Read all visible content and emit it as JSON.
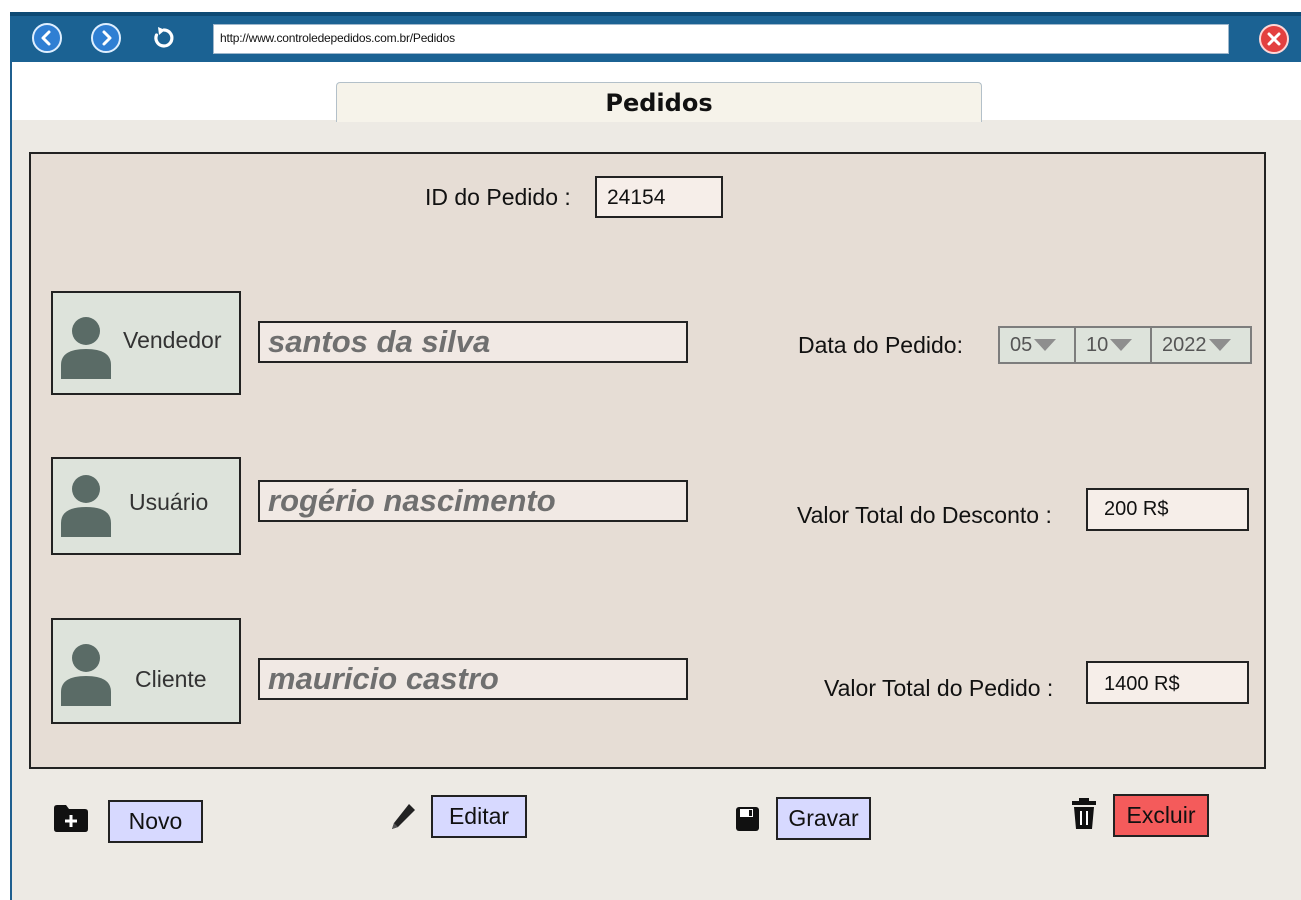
{
  "browser": {
    "url": "http://www.controledepedidos.com.br/Pedidos",
    "icons": [
      "back-icon",
      "forward-icon",
      "reload-icon",
      "close-icon"
    ]
  },
  "page": {
    "tab_title": "Pedidos"
  },
  "order": {
    "id_label": "ID do Pedido :",
    "id_value": "24154",
    "date_label": "Data do Pedido:",
    "date_day": "05",
    "date_month": "10",
    "date_year": "2022",
    "discount_label": "Valor Total do Desconto :",
    "discount_value": "200 R$",
    "total_label": "Valor Total do Pedido :",
    "total_value": "1400 R$"
  },
  "people": {
    "vendedor_label": "Vendedor",
    "vendedor_value": "santos da silva",
    "usuario_label": "Usuário",
    "usuario_value": "rogério nascimento",
    "cliente_label": "Cliente",
    "cliente_value": "mauricio castro"
  },
  "actions": {
    "novo": "Novo",
    "editar": "Editar",
    "gravar": "Gravar",
    "excluir": "Excluir"
  },
  "colors": {
    "browser_bar": "#1b6293",
    "panel_background": "#e6ddd5",
    "action_blue": "#d7d9ff",
    "action_red": "#f45b5b"
  }
}
